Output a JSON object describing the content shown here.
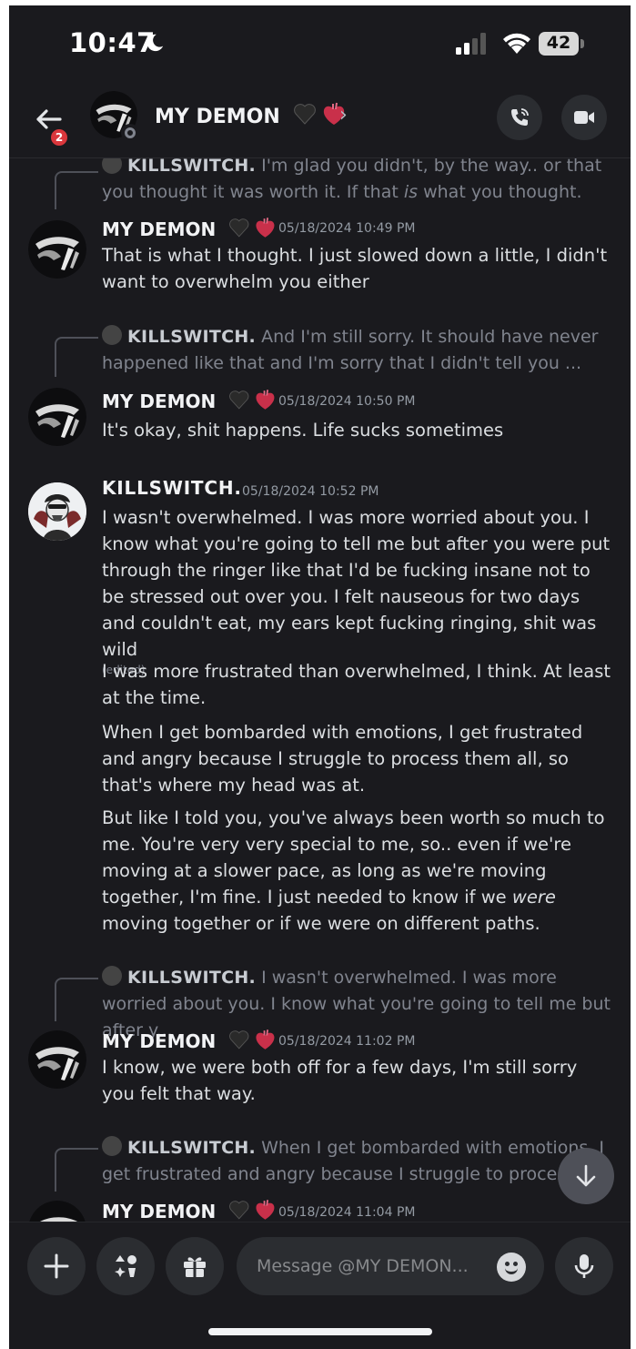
{
  "status_bar": {
    "time": "10:47",
    "battery": "42"
  },
  "header": {
    "back_badge": "2",
    "name": "MY DEMON",
    "chevron": "›",
    "icons": [
      "back-arrow-icon",
      "call-icon",
      "video-icon"
    ]
  },
  "messages": [
    {
      "type": "reply",
      "reply_author": "KILLSWITCH.",
      "reply_text_a": "I'm glad you didn't, by the way.. or that you thought it was worth it. If that ",
      "reply_text_em": "is",
      "reply_text_b": " what you thought."
    },
    {
      "type": "message",
      "author": "MY DEMON",
      "timestamp": "05/18/2024 10:49 PM",
      "text": "That is what I thought. I just slowed down a little, I didn't want to overwhelm you either"
    },
    {
      "type": "reply",
      "reply_author": "KILLSWITCH.",
      "reply_text": "And I'm still sorry. It should have never happened like that and I'm sorry that I didn't tell you ..."
    },
    {
      "type": "message",
      "author": "MY DEMON",
      "timestamp": "05/18/2024 10:50 PM",
      "text": "It's okay, shit happens. Life sucks sometimes"
    },
    {
      "type": "message",
      "author": "KILLSWITCH.",
      "timestamp": "05/18/2024 10:52 PM",
      "paragraphs": [
        "I wasn't overwhelmed. I was more worried about you. I know what you're going to tell me but after you were put through the ringer like that I'd be fucking insane not to be stressed out over you. I felt nauseous for two days and couldn't eat, my ears kept fucking ringing, shit was wild",
        "I was more frustrated than overwhelmed, I think. At least at the time.",
        "When I get bombarded with emotions, I get frustrated and angry because I struggle to process them all, so that's where my head was at."
      ],
      "edited": "(edited)",
      "last_a": "But like I told you, you've always been worth so much to me. You're very very special to me, so.. even if we're moving at a slower pace, as long as we're moving together, I'm fine. I just needed to know if we ",
      "last_em": "were",
      "last_b": " moving together or if we were on different paths."
    },
    {
      "type": "reply",
      "reply_author": "KILLSWITCH.",
      "reply_text": "I wasn't overwhelmed. I was more worried about you. I know what you're going to tell me but after y..."
    },
    {
      "type": "message",
      "author": "MY DEMON",
      "timestamp": "05/18/2024 11:02 PM",
      "text": "I know, we were both off for a few days, I'm still sorry you felt that way."
    },
    {
      "type": "reply",
      "reply_author": "KILLSWITCH.",
      "reply_text": "When I get bombarded with emotions, I get frustrated and angry because I struggle to proces"
    },
    {
      "type": "message",
      "author": "MY DEMON",
      "timestamp": "05/18/2024 11:04 PM"
    }
  ],
  "composer": {
    "placeholder": "Message @MY DEMON...",
    "icons": [
      "plus-icon",
      "apps-icon",
      "gift-icon",
      "emoji-icon",
      "mic-icon"
    ]
  },
  "colors": {
    "background": "#1a1a1e",
    "button": "#2b2d31",
    "badge": "#da373c"
  }
}
